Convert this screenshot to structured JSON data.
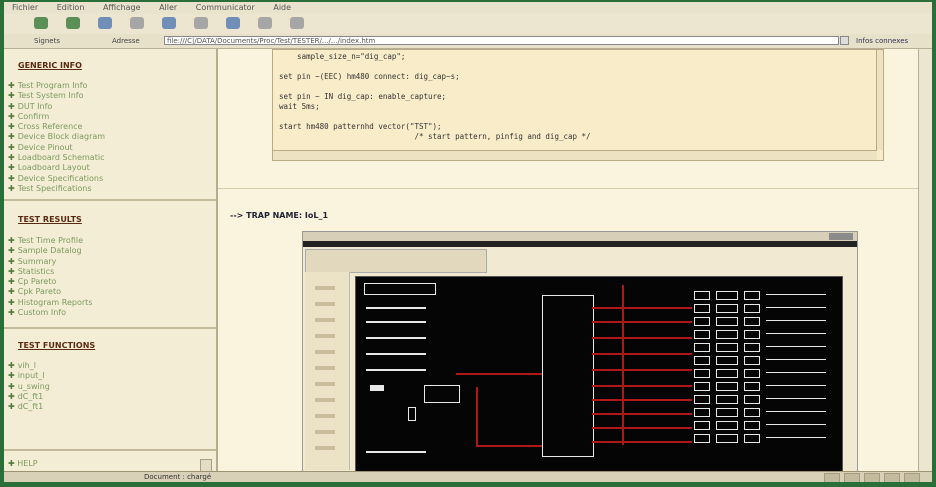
{
  "menu": [
    "Fichier",
    "Edition",
    "Affichage",
    "Aller",
    "Communicator",
    "Aide"
  ],
  "address": {
    "signets_label": "Signets",
    "adresse_label": "Adresse",
    "url": "file:///C|/DATA/Documents/Proc/Test/TESTER/.../.../index.htm",
    "links_label": "Infos connexes"
  },
  "sidebar": {
    "general_title": "GENERIC INFO",
    "general_items": [
      "Test Program Info",
      "Test System Info",
      "DUT Info",
      "Confirm",
      "Cross Reference",
      "Device Block diagram",
      "Device Pinout",
      "Loadboard Schematic",
      "Loadboard Layout",
      "Device Specifications",
      "Test Specifications"
    ],
    "results_title": "TEST RESULTS",
    "results_items": [
      "Test Time Profile",
      "Sample Datalog",
      "Summary",
      "Statistics",
      "Cp Pareto",
      "Cpk Pareto",
      "Histogram Reports",
      "Custom Info"
    ],
    "functions_title": "TEST FUNCTIONS",
    "functions_items": [
      "vih_l",
      "input_l",
      "u_swing",
      "dC_ft1",
      "dC_ft1"
    ],
    "help_label": "HELP"
  },
  "code_lines": [
    "    sample_size_n=\"dig_cap\";",
    "set pin ~(EEC) hm480 connect: dig_cap~s;",
    "set pin ~ IN dig_cap: enable_capture;",
    "wait 5ms;",
    "start hm480 patternhd vector(\"TST\");",
    "                              /* start pattern, pinfig and dig_cap */"
  ],
  "trap_heading": "--> TRAP NAME: IoL_1",
  "status": {
    "text": "Document : chargé"
  },
  "colors": {
    "window_frame": "#2a6e3a",
    "sidebar_bg": "#f3edd6",
    "section_title": "#5a2a12",
    "link_green": "#7c9a5e",
    "code_bg": "#f9edc9",
    "schematic_bg": "#050505",
    "schematic_bus": "#b01818"
  }
}
